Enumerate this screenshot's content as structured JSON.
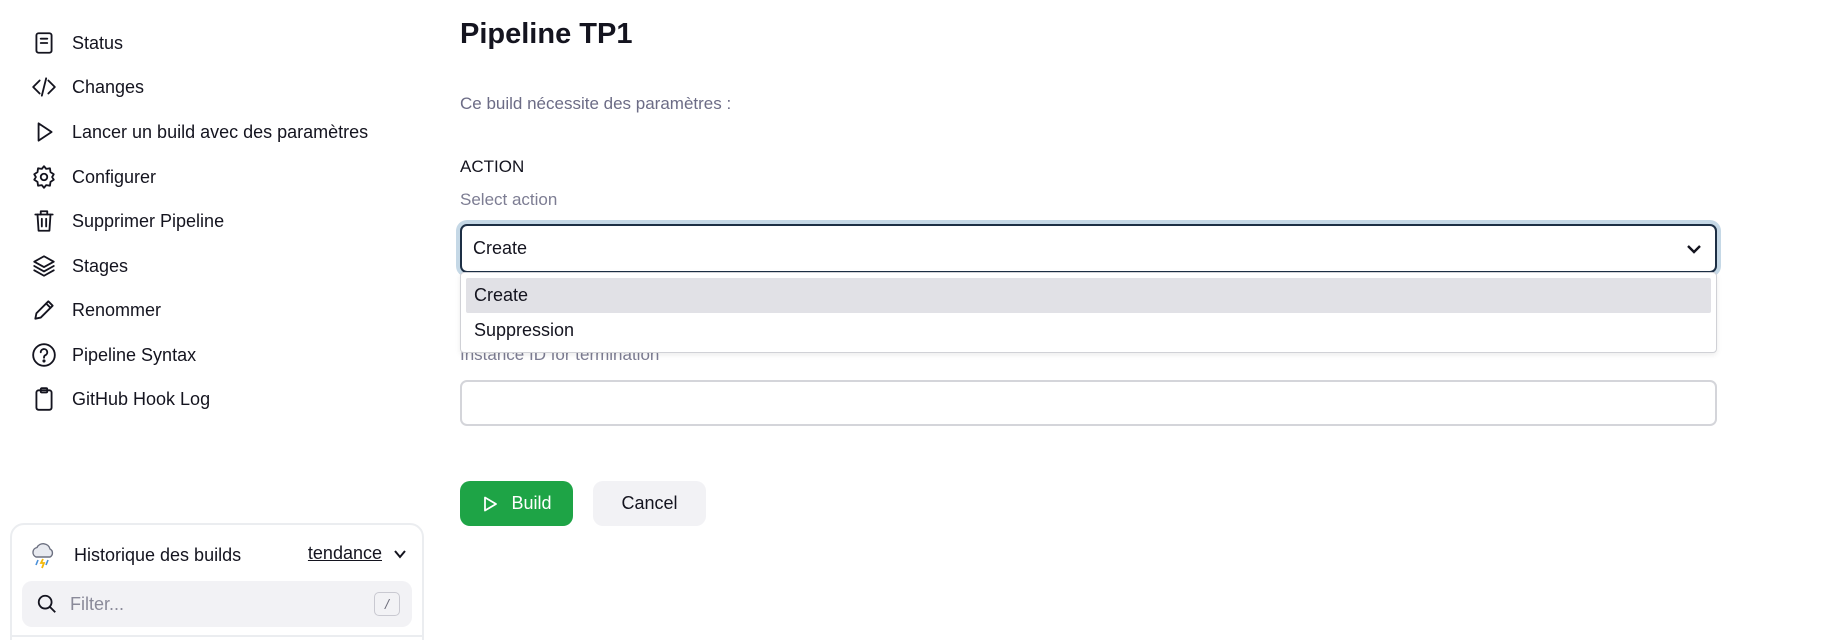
{
  "sidebar": {
    "items": [
      {
        "label": "Status",
        "icon": "document-icon"
      },
      {
        "label": "Changes",
        "icon": "code-icon"
      },
      {
        "label": "Lancer un build avec des paramètres",
        "icon": "play-icon"
      },
      {
        "label": "Configurer",
        "icon": "gear-icon"
      },
      {
        "label": "Supprimer Pipeline",
        "icon": "trash-icon"
      },
      {
        "label": "Stages",
        "icon": "layers-icon"
      },
      {
        "label": "Renommer",
        "icon": "pencil-icon"
      },
      {
        "label": "Pipeline Syntax",
        "icon": "help-circle-icon"
      },
      {
        "label": "GitHub Hook Log",
        "icon": "clipboard-icon"
      }
    ]
  },
  "build_history": {
    "title": "Historique des builds",
    "trend_label": "tendance",
    "filter_placeholder": "Filter...",
    "shortcut_key": "/"
  },
  "main": {
    "title": "Pipeline TP1",
    "description": "Ce build nécessite des paramètres :",
    "parameter": {
      "name": "ACTION",
      "description": "Select action",
      "selected": "Create",
      "options": [
        "Create",
        "Suppression"
      ]
    },
    "instance": {
      "label": "Instance ID for termination",
      "value": ""
    },
    "buttons": {
      "build": "Build",
      "cancel": "Cancel"
    }
  },
  "colors": {
    "accent_green": "#1ea446",
    "focus_ring": "#c5d8e6",
    "text": "#14141f"
  }
}
